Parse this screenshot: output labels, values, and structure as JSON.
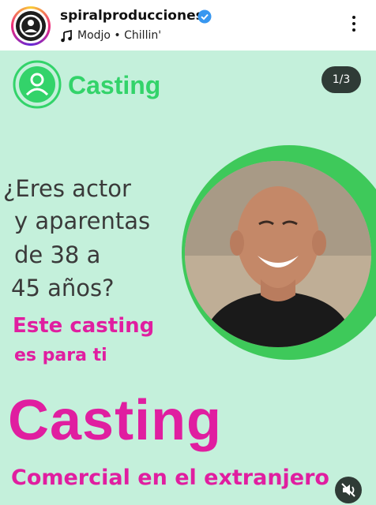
{
  "header": {
    "username": "spiralproducciones",
    "music": "Modjo • Chillin'",
    "icons": {
      "verified": "verified-badge-icon",
      "music": "music-note-icon",
      "more": "more-vertical-icon"
    }
  },
  "post": {
    "logo_text": "Casting",
    "counter": "1/3",
    "question_lines": [
      "¿Eres actor",
      "y aparentas",
      "de 38 a",
      "45 años?"
    ],
    "subtitle_lines": [
      "Este casting",
      "es para ti"
    ],
    "big_title": "Casting",
    "subtitle_bottom": "Comercial en el extranjero",
    "colors": {
      "background": "#c4f0db",
      "green": "#33d36a",
      "pink": "#e01ea0",
      "text": "#3a3a3a"
    }
  }
}
